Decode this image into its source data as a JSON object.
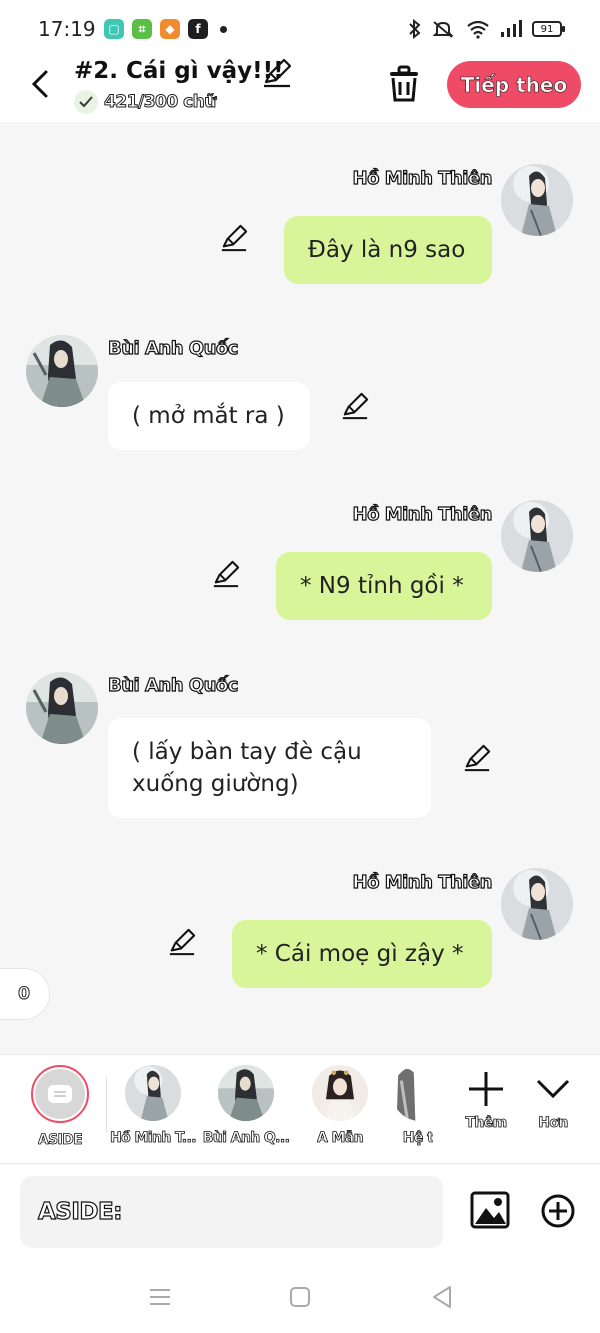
{
  "status": {
    "time": "17:19",
    "battery": "91"
  },
  "header": {
    "title": "#2. Cái gì vậy!!!",
    "word_count": "421/300 chữ",
    "next_label": "Tiếp theo"
  },
  "messages": [
    {
      "side": "right",
      "name": "Hồ Minh Thiên",
      "text": "Đây là n9 sao"
    },
    {
      "side": "left",
      "name": "Bùi Anh Quốc",
      "text": "( mở mắt ra )"
    },
    {
      "side": "right",
      "name": "Hồ Minh Thiên",
      "text": "* N9 tỉnh gồi *"
    },
    {
      "side": "left",
      "name": "Bùi Anh Quốc",
      "text": "( lấy bàn tay đè cậu xuống giường)"
    },
    {
      "side": "right",
      "name": "Hồ Minh Thiên",
      "text": "* Cái moẹ gì zậy *"
    }
  ],
  "side_counter": "0",
  "characters": {
    "aside_label": "ASIDE",
    "items": [
      "Hồ Minh T...",
      "Bùi Anh Q...",
      "A Mẫn",
      "Hệ t"
    ],
    "add_label": "Thêm",
    "more_label": "Hơn"
  },
  "input": {
    "prefix": "ASIDE:"
  },
  "colors": {
    "accent": "#ef4a66",
    "right_bubble": "#d9f599",
    "left_bubble": "#ffffff",
    "background": "#f6f6f6"
  }
}
